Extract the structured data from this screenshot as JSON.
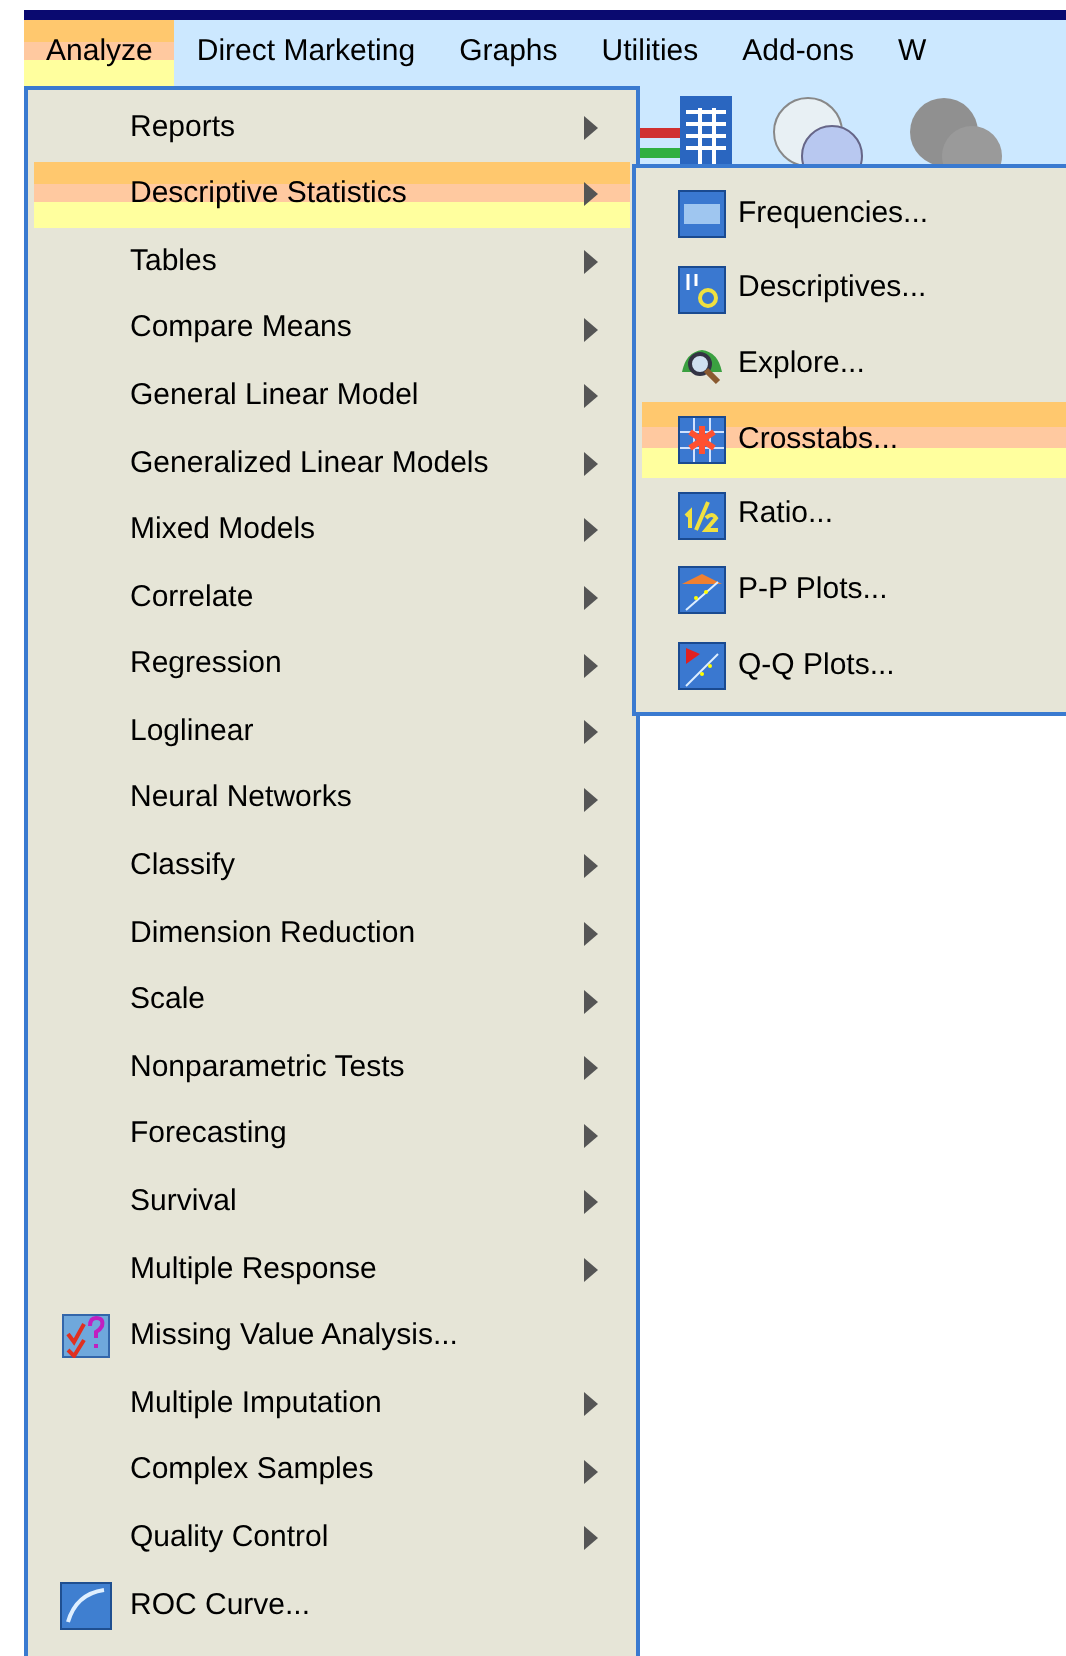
{
  "menu_bar": [
    {
      "label": "Analyze",
      "selected": true
    },
    {
      "label": "Direct Marketing",
      "selected": false
    },
    {
      "label": "Graphs",
      "selected": false
    },
    {
      "label": "Utilities",
      "selected": false
    },
    {
      "label": "Add-ons",
      "selected": false
    },
    {
      "label": "W",
      "selected": false
    }
  ],
  "analyze_menu": [
    {
      "label": "Reports",
      "kind": "submenu",
      "selected": false
    },
    {
      "label": "Descriptive Statistics",
      "kind": "submenu",
      "selected": true
    },
    {
      "label": "Tables",
      "kind": "submenu",
      "selected": false
    },
    {
      "label": "Compare Means",
      "kind": "submenu",
      "selected": false
    },
    {
      "label": "General Linear Model",
      "kind": "submenu",
      "selected": false
    },
    {
      "label": "Generalized Linear Models",
      "kind": "submenu",
      "selected": false
    },
    {
      "label": "Mixed Models",
      "kind": "submenu",
      "selected": false
    },
    {
      "label": "Correlate",
      "kind": "submenu",
      "selected": false
    },
    {
      "label": "Regression",
      "kind": "submenu",
      "selected": false
    },
    {
      "label": "Loglinear",
      "kind": "submenu",
      "selected": false
    },
    {
      "label": "Neural Networks",
      "kind": "submenu",
      "selected": false
    },
    {
      "label": "Classify",
      "kind": "submenu",
      "selected": false
    },
    {
      "label": "Dimension Reduction",
      "kind": "submenu",
      "selected": false
    },
    {
      "label": "Scale",
      "kind": "submenu",
      "selected": false
    },
    {
      "label": "Nonparametric Tests",
      "kind": "submenu",
      "selected": false
    },
    {
      "label": "Forecasting",
      "kind": "submenu",
      "selected": false
    },
    {
      "label": "Survival",
      "kind": "submenu",
      "selected": false
    },
    {
      "label": "Multiple Response",
      "kind": "submenu",
      "selected": false
    },
    {
      "label": "Missing Value Analysis...",
      "kind": "action",
      "selected": false
    },
    {
      "label": "Multiple Imputation",
      "kind": "submenu",
      "selected": false
    },
    {
      "label": "Complex Samples",
      "kind": "submenu",
      "selected": false
    },
    {
      "label": "Quality Control",
      "kind": "submenu",
      "selected": false
    },
    {
      "label": "ROC Curve...",
      "kind": "action",
      "selected": false
    }
  ],
  "descriptive_statistics_submenu": [
    {
      "label": "Frequencies...",
      "selected": false
    },
    {
      "label": "Descriptives...",
      "selected": false
    },
    {
      "label": "Explore...",
      "selected": false
    },
    {
      "label": "Crosstabs...",
      "selected": true
    },
    {
      "label": "Ratio...",
      "selected": false
    },
    {
      "label": "P-P Plots...",
      "selected": false
    },
    {
      "label": "Q-Q Plots...",
      "selected": false
    }
  ]
}
